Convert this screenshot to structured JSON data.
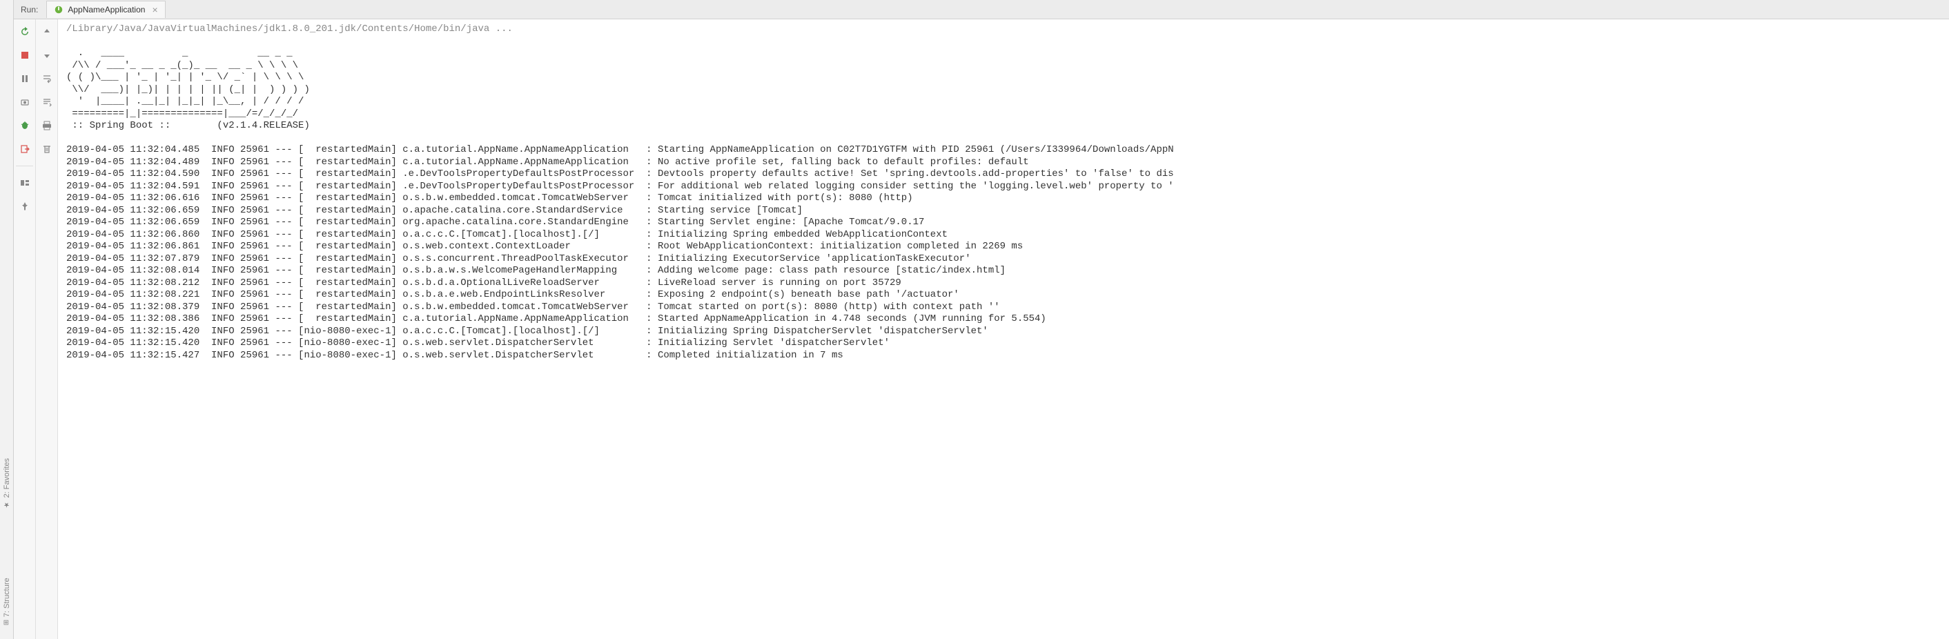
{
  "leftTools": {
    "favorites": "2: Favorites",
    "structure": "7: Structure"
  },
  "tabBar": {
    "runLabel": "Run:",
    "tabName": "AppNameApplication"
  },
  "console": {
    "cmdLine": "/Library/Java/JavaVirtualMachines/jdk1.8.0_201.jdk/Contents/Home/bin/java ...",
    "banner": [
      "  .   ____          _            __ _ _",
      " /\\\\ / ___'_ __ _ _(_)_ __  __ _ \\ \\ \\ \\",
      "( ( )\\___ | '_ | '_| | '_ \\/ _` | \\ \\ \\ \\",
      " \\\\/  ___)| |_)| | | | | || (_| |  ) ) ) )",
      "  '  |____| .__|_| |_|_| |_\\__, | / / / /",
      " =========|_|==============|___/=/_/_/_/",
      " :: Spring Boot ::        (v2.1.4.RELEASE)"
    ],
    "logs": [
      {
        "ts": "2019-04-05 11:32:04.485",
        "lvl": "INFO",
        "pid": "25961",
        "thread": "  restartedMain",
        "logger": "c.a.tutorial.AppName.AppNameApplication  ",
        "msg": "Starting AppNameApplication on C02T7D1YGTFM with PID 25961 (/Users/I339964/Downloads/AppN"
      },
      {
        "ts": "2019-04-05 11:32:04.489",
        "lvl": "INFO",
        "pid": "25961",
        "thread": "  restartedMain",
        "logger": "c.a.tutorial.AppName.AppNameApplication  ",
        "msg": "No active profile set, falling back to default profiles: default"
      },
      {
        "ts": "2019-04-05 11:32:04.590",
        "lvl": "INFO",
        "pid": "25961",
        "thread": "  restartedMain",
        "logger": ".e.DevToolsPropertyDefaultsPostProcessor ",
        "msg": "Devtools property defaults active! Set 'spring.devtools.add-properties' to 'false' to dis"
      },
      {
        "ts": "2019-04-05 11:32:04.591",
        "lvl": "INFO",
        "pid": "25961",
        "thread": "  restartedMain",
        "logger": ".e.DevToolsPropertyDefaultsPostProcessor ",
        "msg": "For additional web related logging consider setting the 'logging.level.web' property to '"
      },
      {
        "ts": "2019-04-05 11:32:06.616",
        "lvl": "INFO",
        "pid": "25961",
        "thread": "  restartedMain",
        "logger": "o.s.b.w.embedded.tomcat.TomcatWebServer  ",
        "msg": "Tomcat initialized with port(s): 8080 (http)"
      },
      {
        "ts": "2019-04-05 11:32:06.659",
        "lvl": "INFO",
        "pid": "25961",
        "thread": "  restartedMain",
        "logger": "o.apache.catalina.core.StandardService   ",
        "msg": "Starting service [Tomcat]"
      },
      {
        "ts": "2019-04-05 11:32:06.659",
        "lvl": "INFO",
        "pid": "25961",
        "thread": "  restartedMain",
        "logger": "org.apache.catalina.core.StandardEngine  ",
        "msg": "Starting Servlet engine: [Apache Tomcat/9.0.17"
      },
      {
        "ts": "2019-04-05 11:32:06.860",
        "lvl": "INFO",
        "pid": "25961",
        "thread": "  restartedMain",
        "logger": "o.a.c.c.C.[Tomcat].[localhost].[/]       ",
        "msg": "Initializing Spring embedded WebApplicationContext"
      },
      {
        "ts": "2019-04-05 11:32:06.861",
        "lvl": "INFO",
        "pid": "25961",
        "thread": "  restartedMain",
        "logger": "o.s.web.context.ContextLoader            ",
        "msg": "Root WebApplicationContext: initialization completed in 2269 ms"
      },
      {
        "ts": "2019-04-05 11:32:07.879",
        "lvl": "INFO",
        "pid": "25961",
        "thread": "  restartedMain",
        "logger": "o.s.s.concurrent.ThreadPoolTaskExecutor  ",
        "msg": "Initializing ExecutorService 'applicationTaskExecutor'"
      },
      {
        "ts": "2019-04-05 11:32:08.014",
        "lvl": "INFO",
        "pid": "25961",
        "thread": "  restartedMain",
        "logger": "o.s.b.a.w.s.WelcomePageHandlerMapping    ",
        "msg": "Adding welcome page: class path resource [static/index.html]"
      },
      {
        "ts": "2019-04-05 11:32:08.212",
        "lvl": "INFO",
        "pid": "25961",
        "thread": "  restartedMain",
        "logger": "o.s.b.d.a.OptionalLiveReloadServer       ",
        "msg": "LiveReload server is running on port 35729"
      },
      {
        "ts": "2019-04-05 11:32:08.221",
        "lvl": "INFO",
        "pid": "25961",
        "thread": "  restartedMain",
        "logger": "o.s.b.a.e.web.EndpointLinksResolver      ",
        "msg": "Exposing 2 endpoint(s) beneath base path '/actuator'"
      },
      {
        "ts": "2019-04-05 11:32:08.379",
        "lvl": "INFO",
        "pid": "25961",
        "thread": "  restartedMain",
        "logger": "o.s.b.w.embedded.tomcat.TomcatWebServer  ",
        "msg": "Tomcat started on port(s): 8080 (http) with context path ''"
      },
      {
        "ts": "2019-04-05 11:32:08.386",
        "lvl": "INFO",
        "pid": "25961",
        "thread": "  restartedMain",
        "logger": "c.a.tutorial.AppName.AppNameApplication  ",
        "msg": "Started AppNameApplication in 4.748 seconds (JVM running for 5.554)"
      },
      {
        "ts": "2019-04-05 11:32:15.420",
        "lvl": "INFO",
        "pid": "25961",
        "thread": "nio-8080-exec-1",
        "logger": "o.a.c.c.C.[Tomcat].[localhost].[/]       ",
        "msg": "Initializing Spring DispatcherServlet 'dispatcherServlet'"
      },
      {
        "ts": "2019-04-05 11:32:15.420",
        "lvl": "INFO",
        "pid": "25961",
        "thread": "nio-8080-exec-1",
        "logger": "o.s.web.servlet.DispatcherServlet        ",
        "msg": "Initializing Servlet 'dispatcherServlet'"
      },
      {
        "ts": "2019-04-05 11:32:15.427",
        "lvl": "INFO",
        "pid": "25961",
        "thread": "nio-8080-exec-1",
        "logger": "o.s.web.servlet.DispatcherServlet        ",
        "msg": "Completed initialization in 7 ms"
      }
    ]
  }
}
